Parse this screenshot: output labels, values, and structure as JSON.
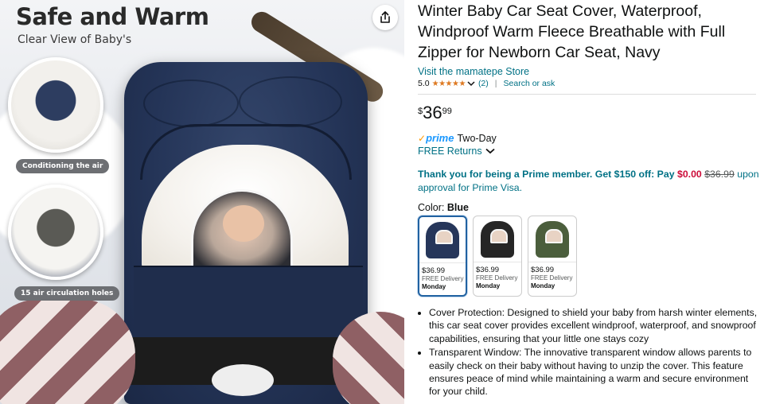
{
  "gallery": {
    "hero_title": "Safe and Warm",
    "hero_subtitle": "Clear View of Baby's",
    "inset_labels": [
      "Conditioning the air",
      "15 air circulation holes"
    ],
    "share_icon": "share-icon"
  },
  "product": {
    "title": "Winter Baby Car Seat Cover, Waterproof, Windproof Warm Fleece Breathable with Full Zipper for Newborn Car Seat, Navy",
    "store_link": "Visit the mamatepe Store",
    "rating_value": "5.0",
    "stars": "★★★★★",
    "rating_count": "(2)",
    "search_link": "Search or ask",
    "price_symbol": "$",
    "price_whole": "36",
    "price_fraction": "99",
    "prime_label": "prime",
    "prime_delivery": "Two-Day",
    "returns_label": "FREE Returns",
    "promo_lead": "Thank you for being a Prime member. Get $150 off: Pay",
    "promo_pay": "$0.00",
    "promo_strike": "$36.99",
    "promo_tail": "upon approval for Prime Visa.",
    "color_label": "Color:",
    "color_value": "Blue",
    "swatches": [
      {
        "price": "$36.99",
        "delivery": "FREE Delivery",
        "day": "Monday",
        "color": "#26365a"
      },
      {
        "price": "$36.99",
        "delivery": "FREE Delivery",
        "day": "Monday",
        "color": "#262626"
      },
      {
        "price": "$36.99",
        "delivery": "FREE Delivery",
        "day": "Monday",
        "color": "#4b5e3c"
      }
    ],
    "bullets": [
      "Cover Protection: Designed to shield your baby from harsh winter elements, this car seat cover provides excellent windproof, waterproof, and snowproof capabilities, ensuring that your little one stays cozy",
      "Transparent Window: The innovative transparent window allows parents to easily check on their baby without having to unzip the cover. This feature ensures peace of mind while maintaining a warm and secure environment for your child."
    ]
  },
  "colors": {
    "link": "#007185",
    "star": "#de7921",
    "prime_blue": "#1a98ff",
    "deal_red": "#cc0c39",
    "selected_border": "#2162a1"
  }
}
